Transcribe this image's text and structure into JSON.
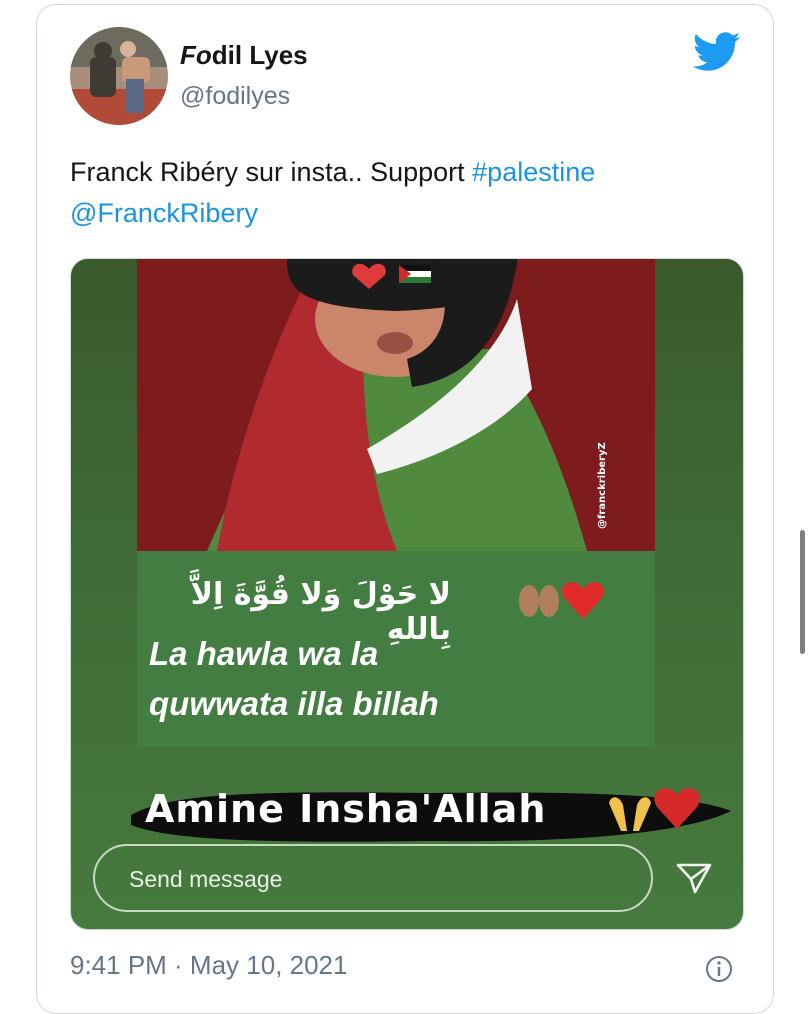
{
  "tweet": {
    "author_name_italic": "Fo",
    "author_name_rest": "dil Lyes",
    "handle": "@fodilyes",
    "text_plain": "Franck Ribéry sur insta.. Support ",
    "hashtag": "#palestine",
    "mention": "@FranckRibery",
    "timestamp": "9:41 PM · May 10, 2021"
  },
  "media": {
    "watermark": "@franckriberyZ",
    "arabic_line": "لا حَوْلَ وَلا قُوَّةَ اِلاَّ بِاللهِ",
    "latin_line_1": "La hawla wa la",
    "latin_line_2": "quwwata illa billah",
    "amine_text": "Amine Insha'Allah",
    "send_placeholder": "Send message"
  },
  "colors": {
    "link": "#1b95e0",
    "twitter_blue": "#1d9bf0",
    "muted": "#657786"
  }
}
